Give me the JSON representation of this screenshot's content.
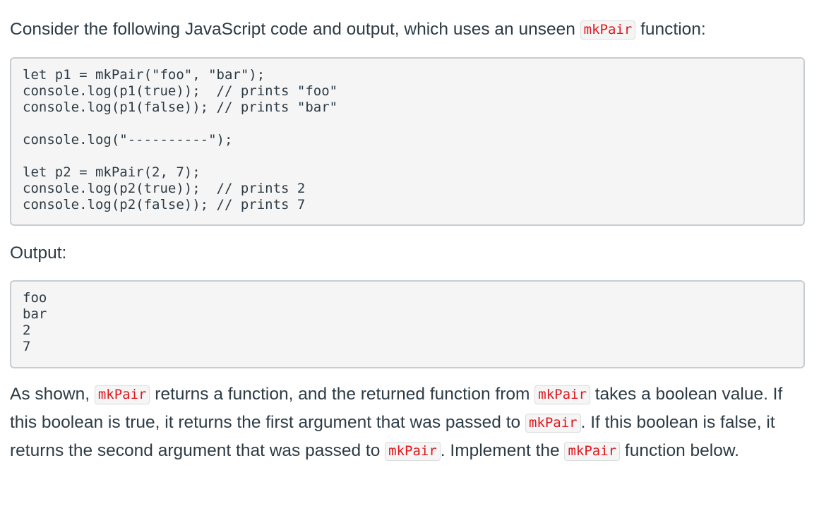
{
  "intro": {
    "before": "Consider the following JavaScript code and output, which uses an unseen ",
    "code": "mkPair",
    "after": " function:"
  },
  "code_block": {
    "lines": [
      "let p1 = mkPair(\"foo\", \"bar\");",
      "console.log(p1(true));  // prints \"foo\"",
      "console.log(p1(false)); // prints \"bar\"",
      "",
      "console.log(\"----------\");",
      "",
      "let p2 = mkPair(2, 7);",
      "console.log(p2(true));  // prints 2",
      "console.log(p2(false)); // prints 7"
    ]
  },
  "output_label": "Output:",
  "output_block": {
    "lines": [
      "foo",
      "bar",
      "2",
      "7"
    ]
  },
  "description": {
    "t1": "As shown, ",
    "c1": "mkPair",
    "t2": " returns a function, and the returned function from ",
    "c2": "mkPair",
    "t3": " takes a boolean value. If this boolean is true, it returns the first argument that was passed to ",
    "c3": "mkPair",
    "t4": ". If this boolean is false, it returns the second argument that was passed to ",
    "c4": "mkPair",
    "t5": ". Implement the ",
    "c5": "mkPair",
    "t6": " function below."
  },
  "colors": {
    "text": "#2d3b45",
    "inline_code": "#e0171d",
    "code_bg": "#f5f5f5",
    "code_border": "#c7cdd1"
  }
}
